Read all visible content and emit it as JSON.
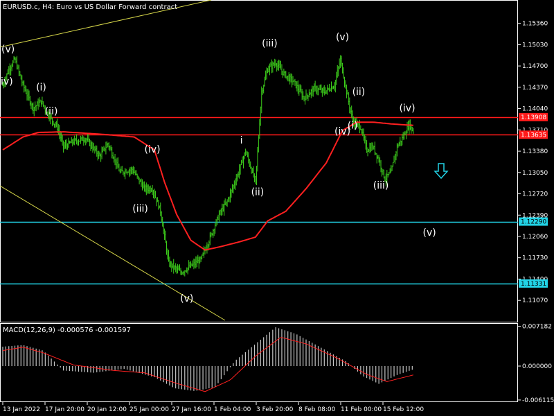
{
  "chart_data": {
    "type": "candlestick",
    "title": "EURUSD.c, H4:  Euro vs US Dollar Forward contract",
    "colors": {
      "background": "#000000",
      "candles": "#3ed01c",
      "ma_line": "#ff2020",
      "resistance": "#ff1a1a",
      "support": "#22d3e6",
      "trendline": "#d8d84a",
      "macd_hist": "#c8c8c8",
      "macd_signal": "#ff2020",
      "arrow": "#22d3e6"
    },
    "price_axis": {
      "ylim": [
        1.1075,
        1.157
      ],
      "ticks": [
        "1.15360",
        "1.15030",
        "1.14700",
        "1.14370",
        "1.14040",
        "1.13710",
        "1.13380",
        "1.13050",
        "1.12720",
        "1.12390",
        "1.12060",
        "1.11730",
        "1.11400",
        "1.11070"
      ]
    },
    "time_axis": {
      "labels": [
        "13 Jan 2022",
        "17 Jan 20:00",
        "20 Jan 12:00",
        "25 Jan 00:00",
        "27 Jan 16:00",
        "1 Feb 04:00",
        "3 Feb 20:00",
        "8 Feb 08:00",
        "11 Feb 00:00",
        "15 Feb 12:00"
      ]
    },
    "horizontal_levels": [
      {
        "label": "1.13908",
        "value": 1.13908,
        "kind": "resistance"
      },
      {
        "label": "1.13635",
        "value": 1.13635,
        "kind": "resistance"
      },
      {
        "label": "1.12290",
        "value": 1.1229,
        "kind": "support"
      },
      {
        "label": "1.11331",
        "value": 1.11331,
        "kind": "support"
      }
    ],
    "price_series": [
      {
        "idx": 0,
        "price": 1.144
      },
      {
        "idx": 6,
        "price": 1.1465
      },
      {
        "idx": 12,
        "price": 1.148
      },
      {
        "idx": 20,
        "price": 1.144
      },
      {
        "idx": 30,
        "price": 1.1405
      },
      {
        "idx": 38,
        "price": 1.1415
      },
      {
        "idx": 46,
        "price": 1.1392
      },
      {
        "idx": 54,
        "price": 1.1375
      },
      {
        "idx": 60,
        "price": 1.1345
      },
      {
        "idx": 70,
        "price": 1.1353
      },
      {
        "idx": 82,
        "price": 1.1358
      },
      {
        "idx": 96,
        "price": 1.133
      },
      {
        "idx": 104,
        "price": 1.135
      },
      {
        "idx": 116,
        "price": 1.1305
      },
      {
        "idx": 128,
        "price": 1.131
      },
      {
        "idx": 140,
        "price": 1.128
      },
      {
        "idx": 148,
        "price": 1.128
      },
      {
        "idx": 156,
        "price": 1.1245
      },
      {
        "idx": 164,
        "price": 1.1165
      },
      {
        "idx": 176,
        "price": 1.115
      },
      {
        "idx": 186,
        "price": 1.116
      },
      {
        "idx": 196,
        "price": 1.117
      },
      {
        "idx": 204,
        "price": 1.12
      },
      {
        "idx": 214,
        "price": 1.124
      },
      {
        "idx": 222,
        "price": 1.126
      },
      {
        "idx": 232,
        "price": 1.13
      },
      {
        "idx": 240,
        "price": 1.1338
      },
      {
        "idx": 250,
        "price": 1.129
      },
      {
        "idx": 256,
        "price": 1.143
      },
      {
        "idx": 262,
        "price": 1.1465
      },
      {
        "idx": 270,
        "price": 1.1475
      },
      {
        "idx": 278,
        "price": 1.1458
      },
      {
        "idx": 288,
        "price": 1.1445
      },
      {
        "idx": 298,
        "price": 1.142
      },
      {
        "idx": 308,
        "price": 1.1435
      },
      {
        "idx": 318,
        "price": 1.143
      },
      {
        "idx": 328,
        "price": 1.144
      },
      {
        "idx": 334,
        "price": 1.148
      },
      {
        "idx": 340,
        "price": 1.143
      },
      {
        "idx": 346,
        "price": 1.1385
      },
      {
        "idx": 354,
        "price": 1.1375
      },
      {
        "idx": 360,
        "price": 1.134
      },
      {
        "idx": 366,
        "price": 1.1345
      },
      {
        "idx": 372,
        "price": 1.1325
      },
      {
        "idx": 378,
        "price": 1.1295
      },
      {
        "idx": 384,
        "price": 1.1305
      },
      {
        "idx": 390,
        "price": 1.1345
      },
      {
        "idx": 396,
        "price": 1.136
      },
      {
        "idx": 402,
        "price": 1.138
      },
      {
        "idx": 406,
        "price": 1.1368
      }
    ],
    "ma_series": [
      {
        "idx": 0,
        "price": 1.134
      },
      {
        "idx": 10,
        "price": 1.135
      },
      {
        "idx": 20,
        "price": 1.136
      },
      {
        "idx": 35,
        "price": 1.1367
      },
      {
        "idx": 60,
        "price": 1.1368
      },
      {
        "idx": 100,
        "price": 1.1364
      },
      {
        "idx": 130,
        "price": 1.136
      },
      {
        "idx": 150,
        "price": 1.134
      },
      {
        "idx": 160,
        "price": 1.129
      },
      {
        "idx": 172,
        "price": 1.124
      },
      {
        "idx": 186,
        "price": 1.12
      },
      {
        "idx": 200,
        "price": 1.1185
      },
      {
        "idx": 215,
        "price": 1.119
      },
      {
        "idx": 235,
        "price": 1.1198
      },
      {
        "idx": 250,
        "price": 1.1205
      },
      {
        "idx": 262,
        "price": 1.123
      },
      {
        "idx": 280,
        "price": 1.1245
      },
      {
        "idx": 300,
        "price": 1.128
      },
      {
        "idx": 320,
        "price": 1.132
      },
      {
        "idx": 336,
        "price": 1.137
      },
      {
        "idx": 350,
        "price": 1.1383
      },
      {
        "idx": 366,
        "price": 1.1383
      },
      {
        "idx": 386,
        "price": 1.138
      },
      {
        "idx": 406,
        "price": 1.1378
      }
    ],
    "wave_labels": [
      {
        "text": "i)(v)",
        "idx": 2,
        "price": 1.1491
      },
      {
        "text": "iv)",
        "idx": 4,
        "price": 1.1441
      },
      {
        "text": "(i)",
        "idx": 38,
        "price": 1.1432
      },
      {
        "text": "(ii)",
        "idx": 48,
        "price": 1.1395
      },
      {
        "text": "(iv)",
        "idx": 148,
        "price": 1.1336
      },
      {
        "text": "(iii)",
        "idx": 136,
        "price": 1.1244
      },
      {
        "text": "(v)",
        "idx": 182,
        "price": 1.1105
      },
      {
        "text": "i",
        "idx": 236,
        "price": 1.135
      },
      {
        "text": "(ii)",
        "idx": 252,
        "price": 1.127
      },
      {
        "text": "(iii)",
        "idx": 264,
        "price": 1.15
      },
      {
        "text": "(v)",
        "idx": 336,
        "price": 1.151
      },
      {
        "text": "(ii)",
        "idx": 352,
        "price": 1.1425
      },
      {
        "text": "(iv)",
        "idx": 336,
        "price": 1.1364
      },
      {
        "text": "(i)",
        "idx": 346,
        "price": 1.1373
      },
      {
        "text": "(iii)",
        "idx": 374,
        "price": 1.128
      },
      {
        "text": "(iv)",
        "idx": 400,
        "price": 1.14
      },
      {
        "text": "(v)",
        "idx": 422,
        "price": 1.1207
      }
    ],
    "macd": {
      "label": "MACD(12,26,9) -0.000576 -0.001597",
      "ylim": [
        -0.00625,
        0.0075
      ],
      "ticks": [
        "0.007182",
        "0.000000",
        "-0.006115"
      ],
      "hist": [
        {
          "idx": 0,
          "value": 0.0035
        },
        {
          "idx": 20,
          "value": 0.0038
        },
        {
          "idx": 40,
          "value": 0.0028
        },
        {
          "idx": 60,
          "value": -0.0008
        },
        {
          "idx": 90,
          "value": -0.0012
        },
        {
          "idx": 120,
          "value": -0.0005
        },
        {
          "idx": 150,
          "value": -0.002
        },
        {
          "idx": 170,
          "value": -0.004
        },
        {
          "idx": 190,
          "value": -0.0045
        },
        {
          "idx": 210,
          "value": -0.0038
        },
        {
          "idx": 230,
          "value": 0.001
        },
        {
          "idx": 250,
          "value": 0.004
        },
        {
          "idx": 270,
          "value": 0.007
        },
        {
          "idx": 290,
          "value": 0.0058
        },
        {
          "idx": 310,
          "value": 0.0038
        },
        {
          "idx": 340,
          "value": 0.0008
        },
        {
          "idx": 356,
          "value": -0.0018
        },
        {
          "idx": 372,
          "value": -0.0032
        },
        {
          "idx": 390,
          "value": -0.0016
        },
        {
          "idx": 406,
          "value": -0.0006
        }
      ],
      "signal": [
        {
          "idx": 0,
          "value": 0.0028
        },
        {
          "idx": 20,
          "value": 0.0034
        },
        {
          "idx": 40,
          "value": 0.0024
        },
        {
          "idx": 70,
          "value": 0.0002
        },
        {
          "idx": 110,
          "value": -0.0008
        },
        {
          "idx": 140,
          "value": -0.0012
        },
        {
          "idx": 170,
          "value": -0.003
        },
        {
          "idx": 200,
          "value": -0.0046
        },
        {
          "idx": 225,
          "value": -0.0025
        },
        {
          "idx": 250,
          "value": 0.0018
        },
        {
          "idx": 275,
          "value": 0.0052
        },
        {
          "idx": 300,
          "value": 0.004
        },
        {
          "idx": 330,
          "value": 0.0015
        },
        {
          "idx": 360,
          "value": -0.0015
        },
        {
          "idx": 380,
          "value": -0.0028
        },
        {
          "idx": 406,
          "value": -0.0016
        }
      ]
    }
  }
}
